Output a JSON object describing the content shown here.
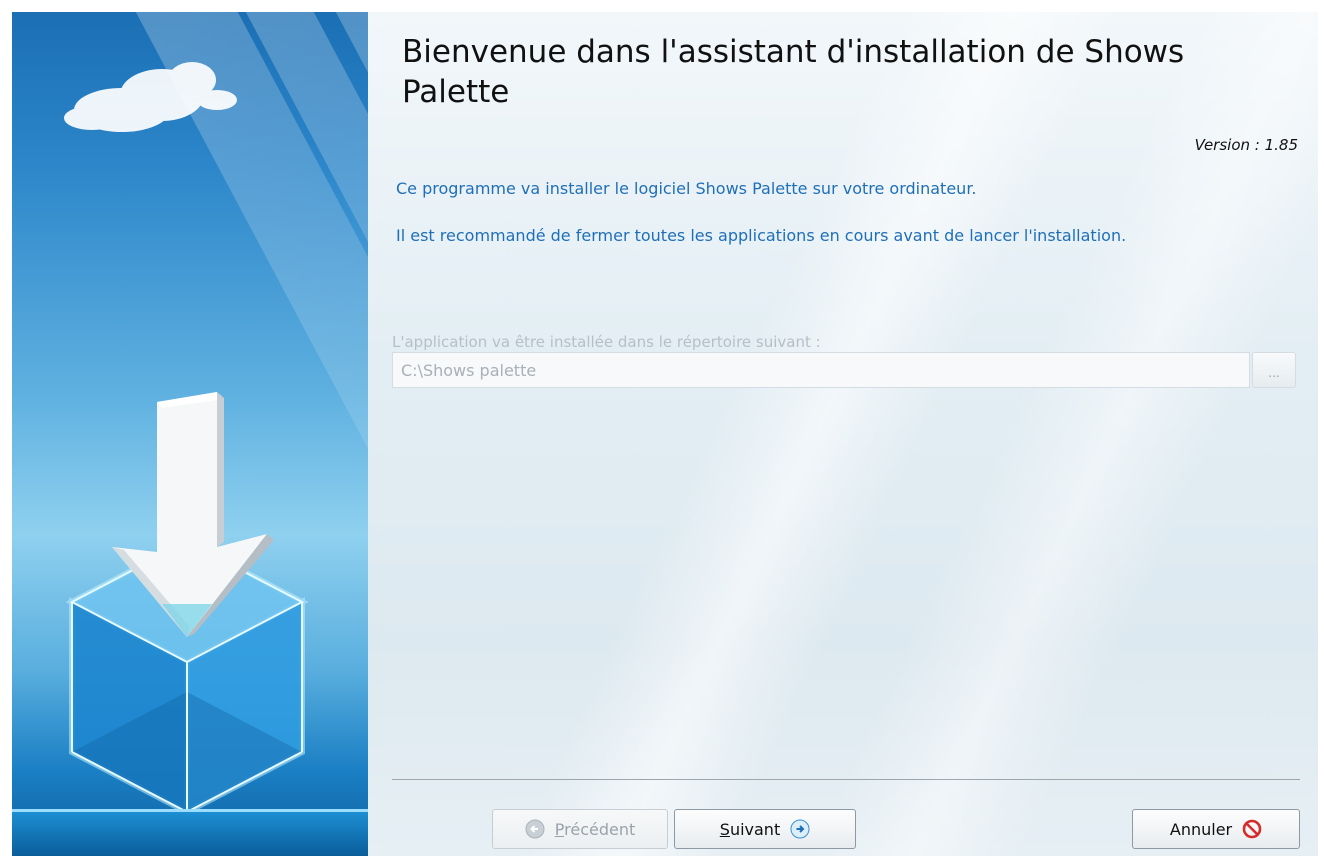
{
  "wizard": {
    "title": "Bienvenue dans l'assistant d'installation de Shows Palette",
    "version": "Version : 1.85",
    "intro_line1": "Ce programme va installer le logiciel Shows Palette sur votre ordinateur.",
    "intro_line2": "Il est recommandé de fermer toutes les applications en cours avant de lancer l'installation.",
    "directory_label": "L'application va être installée dans le répertoire suivant :",
    "directory_value": "C:\\Shows palette",
    "browse_label": "..."
  },
  "buttons": {
    "previous_mnemonic": "P",
    "previous_rest": "récédent",
    "next_mnemonic": "S",
    "next_rest": "uivant",
    "cancel": "Annuler"
  },
  "icons": {
    "previous": "arrow-left-circle-icon",
    "next": "arrow-right-circle-icon",
    "cancel": "prohibited-icon",
    "illustration": "download-arrow-box-icon"
  },
  "colors": {
    "accent_text": "#1f6fb8",
    "cancel_icon": "#d62b2b"
  }
}
